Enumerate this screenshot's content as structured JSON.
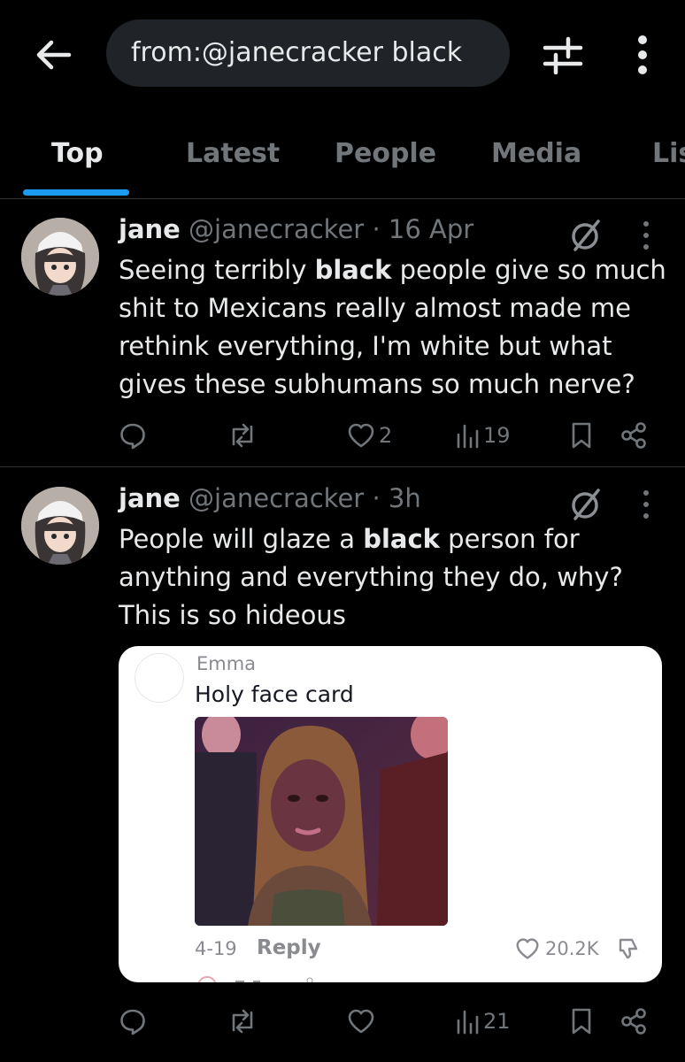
{
  "search": {
    "query": "from:@janecracker black"
  },
  "icons": {
    "back": "arrow-left-icon",
    "filter": "sliders-icon",
    "more": "more-vertical-icon"
  },
  "tabs": [
    {
      "label": "Top",
      "active": true
    },
    {
      "label": "Latest",
      "active": false
    },
    {
      "label": "People",
      "active": false
    },
    {
      "label": "Media",
      "active": false
    },
    {
      "label": "Lis",
      "active": false
    }
  ],
  "colors": {
    "accent": "#1d9bf0",
    "muted": "#71767b",
    "text": "#e7e9ea",
    "background": "#000000"
  },
  "tweets": [
    {
      "name": "jane",
      "handle": "@janecracker",
      "time": "· 16 Apr",
      "text_parts": [
        "Seeing terribly ",
        "black",
        " people give so much shit to Mexicans really almost made me rethink everything, I'm white but what gives these subhumans so much nerve?"
      ],
      "replies": "",
      "reposts": "",
      "likes": "2",
      "views": "19"
    },
    {
      "name": "jane",
      "handle": "@janecracker",
      "time": "· 3h",
      "text_parts": [
        "People will glaze a ",
        "black",
        " person for anything and everything they do, why? This is so hideous"
      ],
      "replies": "",
      "reposts": "",
      "likes": "",
      "views": "21",
      "quoted_comment": {
        "author": "Emma",
        "text": "Holy face card",
        "date": "4-19",
        "reply_label": "Reply",
        "likes": "20.2K"
      }
    }
  ]
}
